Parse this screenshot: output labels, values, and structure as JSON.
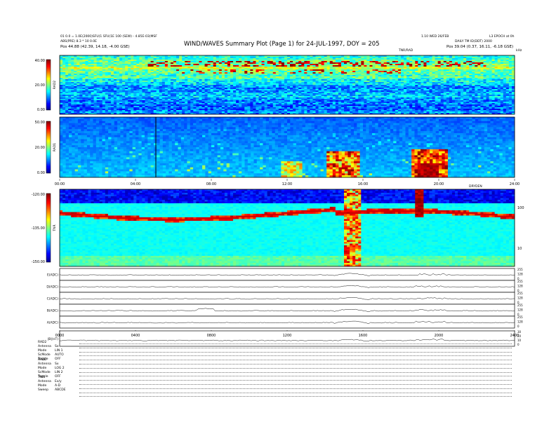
{
  "header": {
    "title": "WIND/WAVES Summary Plot (Page 1) for 24-JUL-1997, DOY = 205",
    "left_line1": "01 0.0 = 1.0E(2000)SFU(1 SFU(1E 100 (SEW) - 4.85E-03(MSF",
    "left_line2": "ABS(PRE) 8.3 * 10 0.0E",
    "left_pos_label": "Pos",
    "left_pos_value": "44.88 (42.39, 14.18, -4.00 GSE)",
    "right_line1": "1.10 WED 26/FEB",
    "right_line1b": "L3 EPOCH at 0h",
    "right_line2": "DAILY TM ID(DDT) 2000",
    "right_pos_label": "Pos",
    "right_pos_value": "39.04 (0.37, 16.11, -6.18 GSE)",
    "top_center_label": "TNR/RAD",
    "top_right_label": "kHz"
  },
  "chart_data": [
    {
      "type": "heatmap",
      "name": "RAD2",
      "ylabel": "RAD2",
      "ylim": [
        0,
        40
      ],
      "yticks": [
        "40.00",
        "20.00",
        "0.00"
      ],
      "colormap": "jet",
      "features": "narrow horizontal emission bands between 12 and 40, strongest near 30-35"
    },
    {
      "type": "heatmap",
      "name": "RAD1",
      "ylabel": "RAD1",
      "ylim": [
        0,
        50
      ],
      "yticks": [
        "50.00",
        "20.00",
        "0.00"
      ],
      "colormap": "jet",
      "features": "type III bursts, strong activity 14:00-16:00 and 19:00-21:00",
      "xticks": [
        "00:00",
        "04:00",
        "08:00",
        "12:00",
        "16:00",
        "20:00",
        "24:00"
      ],
      "right_label": "DRYDEN"
    },
    {
      "type": "heatmap",
      "name": "TNR",
      "ylabel": "TNR",
      "ylim": [
        -150,
        -120
      ],
      "yticks": [
        "-120.00",
        "-135.00",
        "-150.00"
      ],
      "right_yticks": [
        "100",
        "10"
      ],
      "colormap": "jet",
      "features": "plasma line band near -128, burst columns at 15:00-16:00 and 19:00"
    },
    {
      "type": "line",
      "name": "stacked traces",
      "series": [
        {
          "name": "E(ADC)"
        },
        {
          "name": "D(ADC)"
        },
        {
          "name": "C(ADC)"
        },
        {
          "name": "B(ADC)"
        },
        {
          "name": "A(ADC)"
        },
        {
          "name": "|B|(nT)"
        }
      ],
      "right_ticks": [
        "255",
        "128",
        "0"
      ],
      "mag_ticks": [
        "30",
        "20",
        "10",
        "0"
      ],
      "xticks": [
        "0000",
        "0400",
        "0800",
        "1200",
        "1600",
        "2000",
        "2400"
      ]
    }
  ],
  "colorbar": {
    "rad2": [
      "40.00",
      "20.00",
      "0.00"
    ],
    "rad1": [
      "50.00",
      "20.00",
      "0.00"
    ],
    "tnr": [
      "-120.00",
      "-135.00",
      "-150.00"
    ]
  },
  "channels": {
    "rad2_header": "RAD2",
    "rad2_rows": [
      {
        "label": "Antenna",
        "value": "Sx"
      },
      {
        "label": "Mode",
        "value": "LIN 1"
      },
      {
        "label": "ScMode",
        "value": "AUTO"
      },
      {
        "label": "Toggle",
        "value": "OFF"
      }
    ],
    "rad1_header": "RAD1",
    "rad1_rows": [
      {
        "label": "Antenna",
        "value": "Sx"
      },
      {
        "label": "Mode",
        "value": "LOG 2"
      },
      {
        "label": "ScMode",
        "value": "LIN 2"
      },
      {
        "label": "Toggle",
        "value": "OFF"
      }
    ],
    "tnr_header": "TNR",
    "tnr_rows": [
      {
        "label": "Antenna",
        "value": "Ex/y"
      },
      {
        "label": "Mode",
        "value": "A-D"
      },
      {
        "label": "Sweep",
        "value": "ABCDE"
      }
    ]
  },
  "colors": {
    "jet_low": "#00008f",
    "jet_mid": "#00ffff",
    "jet_high": "#ff0000"
  }
}
